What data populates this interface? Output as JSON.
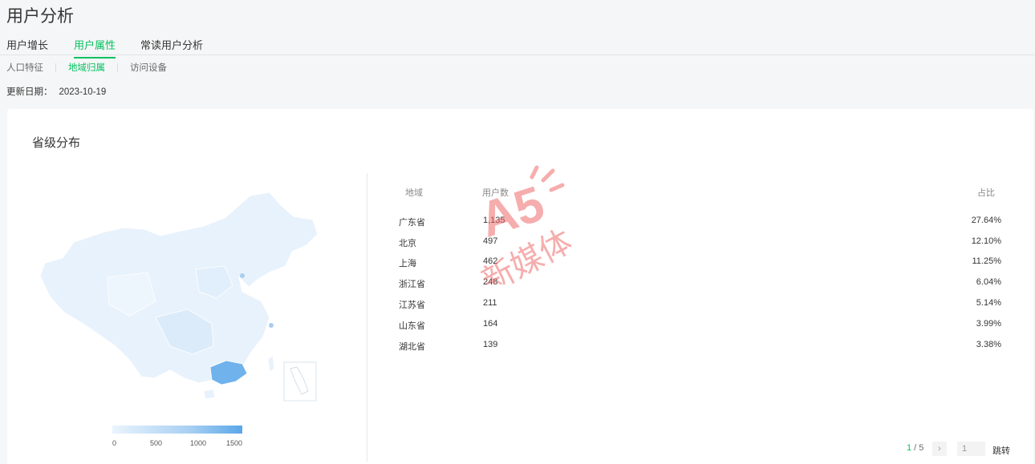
{
  "page": {
    "title": "用户分析"
  },
  "tabs": [
    {
      "label": "用户增长",
      "active": false
    },
    {
      "label": "用户属性",
      "active": true
    },
    {
      "label": "常读用户分析",
      "active": false
    }
  ],
  "subtabs": [
    {
      "label": "人口特征",
      "active": false
    },
    {
      "label": "地域归属",
      "active": true
    },
    {
      "label": "访问设备",
      "active": false
    }
  ],
  "update": {
    "label": "更新日期：",
    "date": "2023-10-19"
  },
  "card": {
    "title": "省级分布"
  },
  "legend": {
    "ticks": [
      "0",
      "500",
      "1000",
      "1500"
    ]
  },
  "table": {
    "headers": {
      "region": "地域",
      "users": "用户数",
      "ratio": "占比"
    },
    "rows": [
      {
        "region": "广东省",
        "users": "1,135",
        "ratio": "27.64%"
      },
      {
        "region": "北京",
        "users": "497",
        "ratio": "12.10%"
      },
      {
        "region": "上海",
        "users": "462",
        "ratio": "11.25%"
      },
      {
        "region": "浙江省",
        "users": "248",
        "ratio": "6.04%"
      },
      {
        "region": "江苏省",
        "users": "211",
        "ratio": "5.14%"
      },
      {
        "region": "山东省",
        "users": "164",
        "ratio": "3.99%"
      },
      {
        "region": "湖北省",
        "users": "139",
        "ratio": "3.38%"
      }
    ]
  },
  "pager": {
    "current": "1",
    "separator": " / ",
    "total": "5",
    "next": "›",
    "input_value": "1",
    "jump": "跳转"
  },
  "watermark": {
    "logo_text": "A5",
    "caption": "新媒体"
  },
  "colors": {
    "accent": "#07c160",
    "map_light": "#e8f2fc",
    "map_highlight": "#6fb2ec"
  }
}
